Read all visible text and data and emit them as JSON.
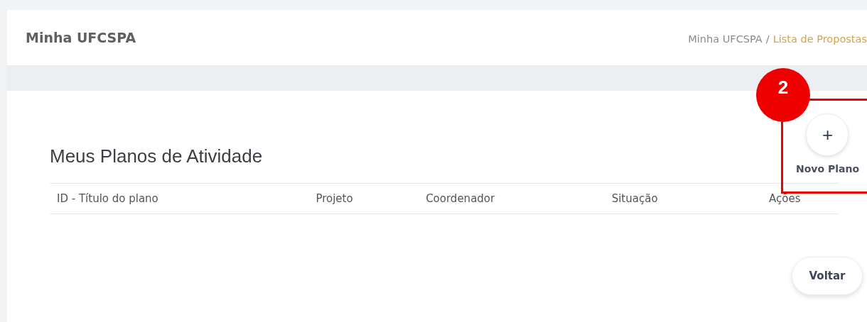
{
  "header": {
    "title": "Minha UFCSPA",
    "breadcrumb": [
      {
        "label": "Minha UFCSPA",
        "selected": false
      },
      {
        "label": "Lista de Propostas",
        "selected": true
      }
    ],
    "separator": "/"
  },
  "page": {
    "title": "Meus Planos de Atividade",
    "new_button": {
      "icon": "+",
      "label": "Novo Plano"
    }
  },
  "table": {
    "columns": [
      "ID - Título do plano",
      "Projeto",
      "Coordenador",
      "Situação",
      "Ações"
    ]
  },
  "back_button": "Voltar",
  "annotation": {
    "number": "2"
  }
}
